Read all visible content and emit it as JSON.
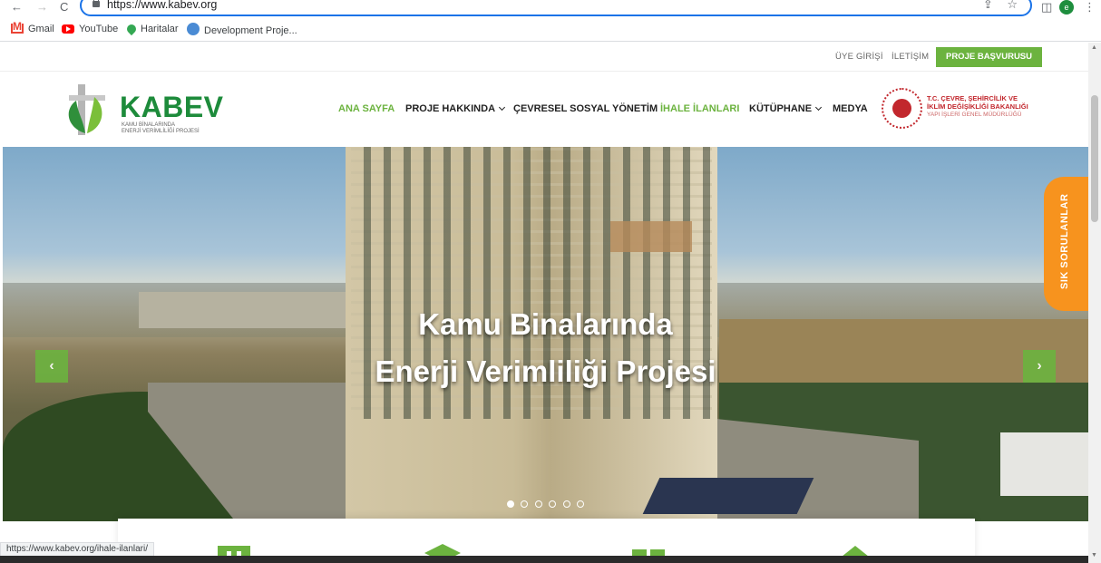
{
  "browser": {
    "url": "https://www.kabev.org",
    "status_url": "https://www.kabev.org/ihale-ilanlari/",
    "bookmarks": [
      "Gmail",
      "YouTube",
      "Haritalar",
      "Development Proje..."
    ],
    "back_glyph": "←",
    "forward_glyph": "→",
    "reload_glyph": "C",
    "share_glyph": "⇪",
    "star_glyph": "☆",
    "sidebar_glyph": "◫",
    "menu_glyph": "⋮",
    "profile_initial": "e"
  },
  "site": {
    "topbar": {
      "login": "ÜYE GİRİŞİ",
      "contact": "İLETİŞİM",
      "apply": "PROJE BAŞVURUSU"
    },
    "logo": {
      "title": "KABEV",
      "subtitle_line1": "KAMU BİNALARINDA",
      "subtitle_line2": "ENERJİ VERİMLİLİĞİ PROJESİ"
    },
    "menu": [
      "ANA SAYFA",
      "PROJE HAKKINDA",
      "ÇEVRESEL SOSYAL YÖNETİM",
      "İHALE İLANLARI",
      "KÜTÜPHANE",
      "MEDYA"
    ],
    "ministry": {
      "line1": "T.C. ÇEVRE, ŞEHİRCİLİK VE",
      "line2": "İKLİM DEĞİŞİKLİĞİ BAKANLIĞI",
      "line3": "YAPI İŞLERİ GENEL MÜDÜRLÜĞÜ"
    },
    "hero": {
      "title_line1": "Kamu Binalarında",
      "title_line2": "Enerji Verimliliği Projesi",
      "prev": "‹",
      "next": "›"
    },
    "faq_tab": "SIK SORULANLAR",
    "colors": {
      "brand_green": "#6cb33f",
      "logo_green": "#1d8b3b",
      "faq_orange": "#f7931e",
      "ministry_red": "#c2272d"
    }
  }
}
